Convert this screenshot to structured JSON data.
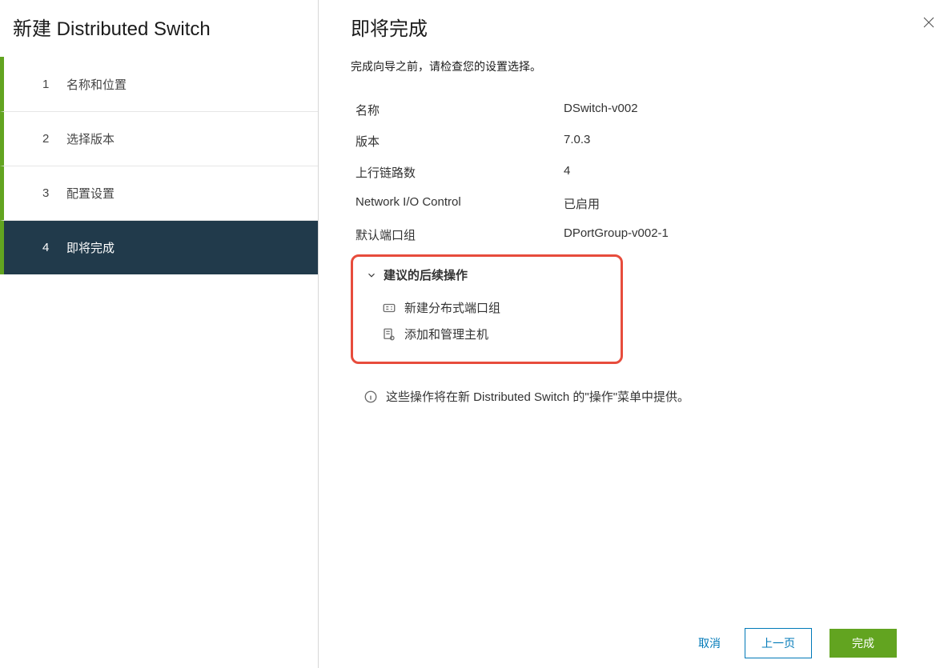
{
  "sidebar": {
    "title": "新建 Distributed Switch",
    "steps": [
      {
        "num": "1",
        "label": "名称和位置"
      },
      {
        "num": "2",
        "label": "选择版本"
      },
      {
        "num": "3",
        "label": "配置设置"
      },
      {
        "num": "4",
        "label": "即将完成"
      }
    ],
    "activeIndex": 3
  },
  "main": {
    "title": "即将完成",
    "subtitle": "完成向导之前，请检查您的设置选择。",
    "summary": {
      "name_label": "名称",
      "name_value": "DSwitch-v002",
      "version_label": "版本",
      "version_value": "7.0.3",
      "uplinks_label": "上行链路数",
      "uplinks_value": "4",
      "nioc_label": "Network I/O Control",
      "nioc_value": "已启用",
      "defaultpg_label": "默认端口组",
      "defaultpg_value": "DPortGroup-v002-1"
    },
    "suggested": {
      "header": "建议的后续操作",
      "item1": "新建分布式端口组",
      "item2": "添加和管理主机"
    },
    "note": "这些操作将在新 Distributed Switch 的\"操作\"菜单中提供。"
  },
  "footer": {
    "cancel": "取消",
    "back": "上一页",
    "finish": "完成"
  }
}
